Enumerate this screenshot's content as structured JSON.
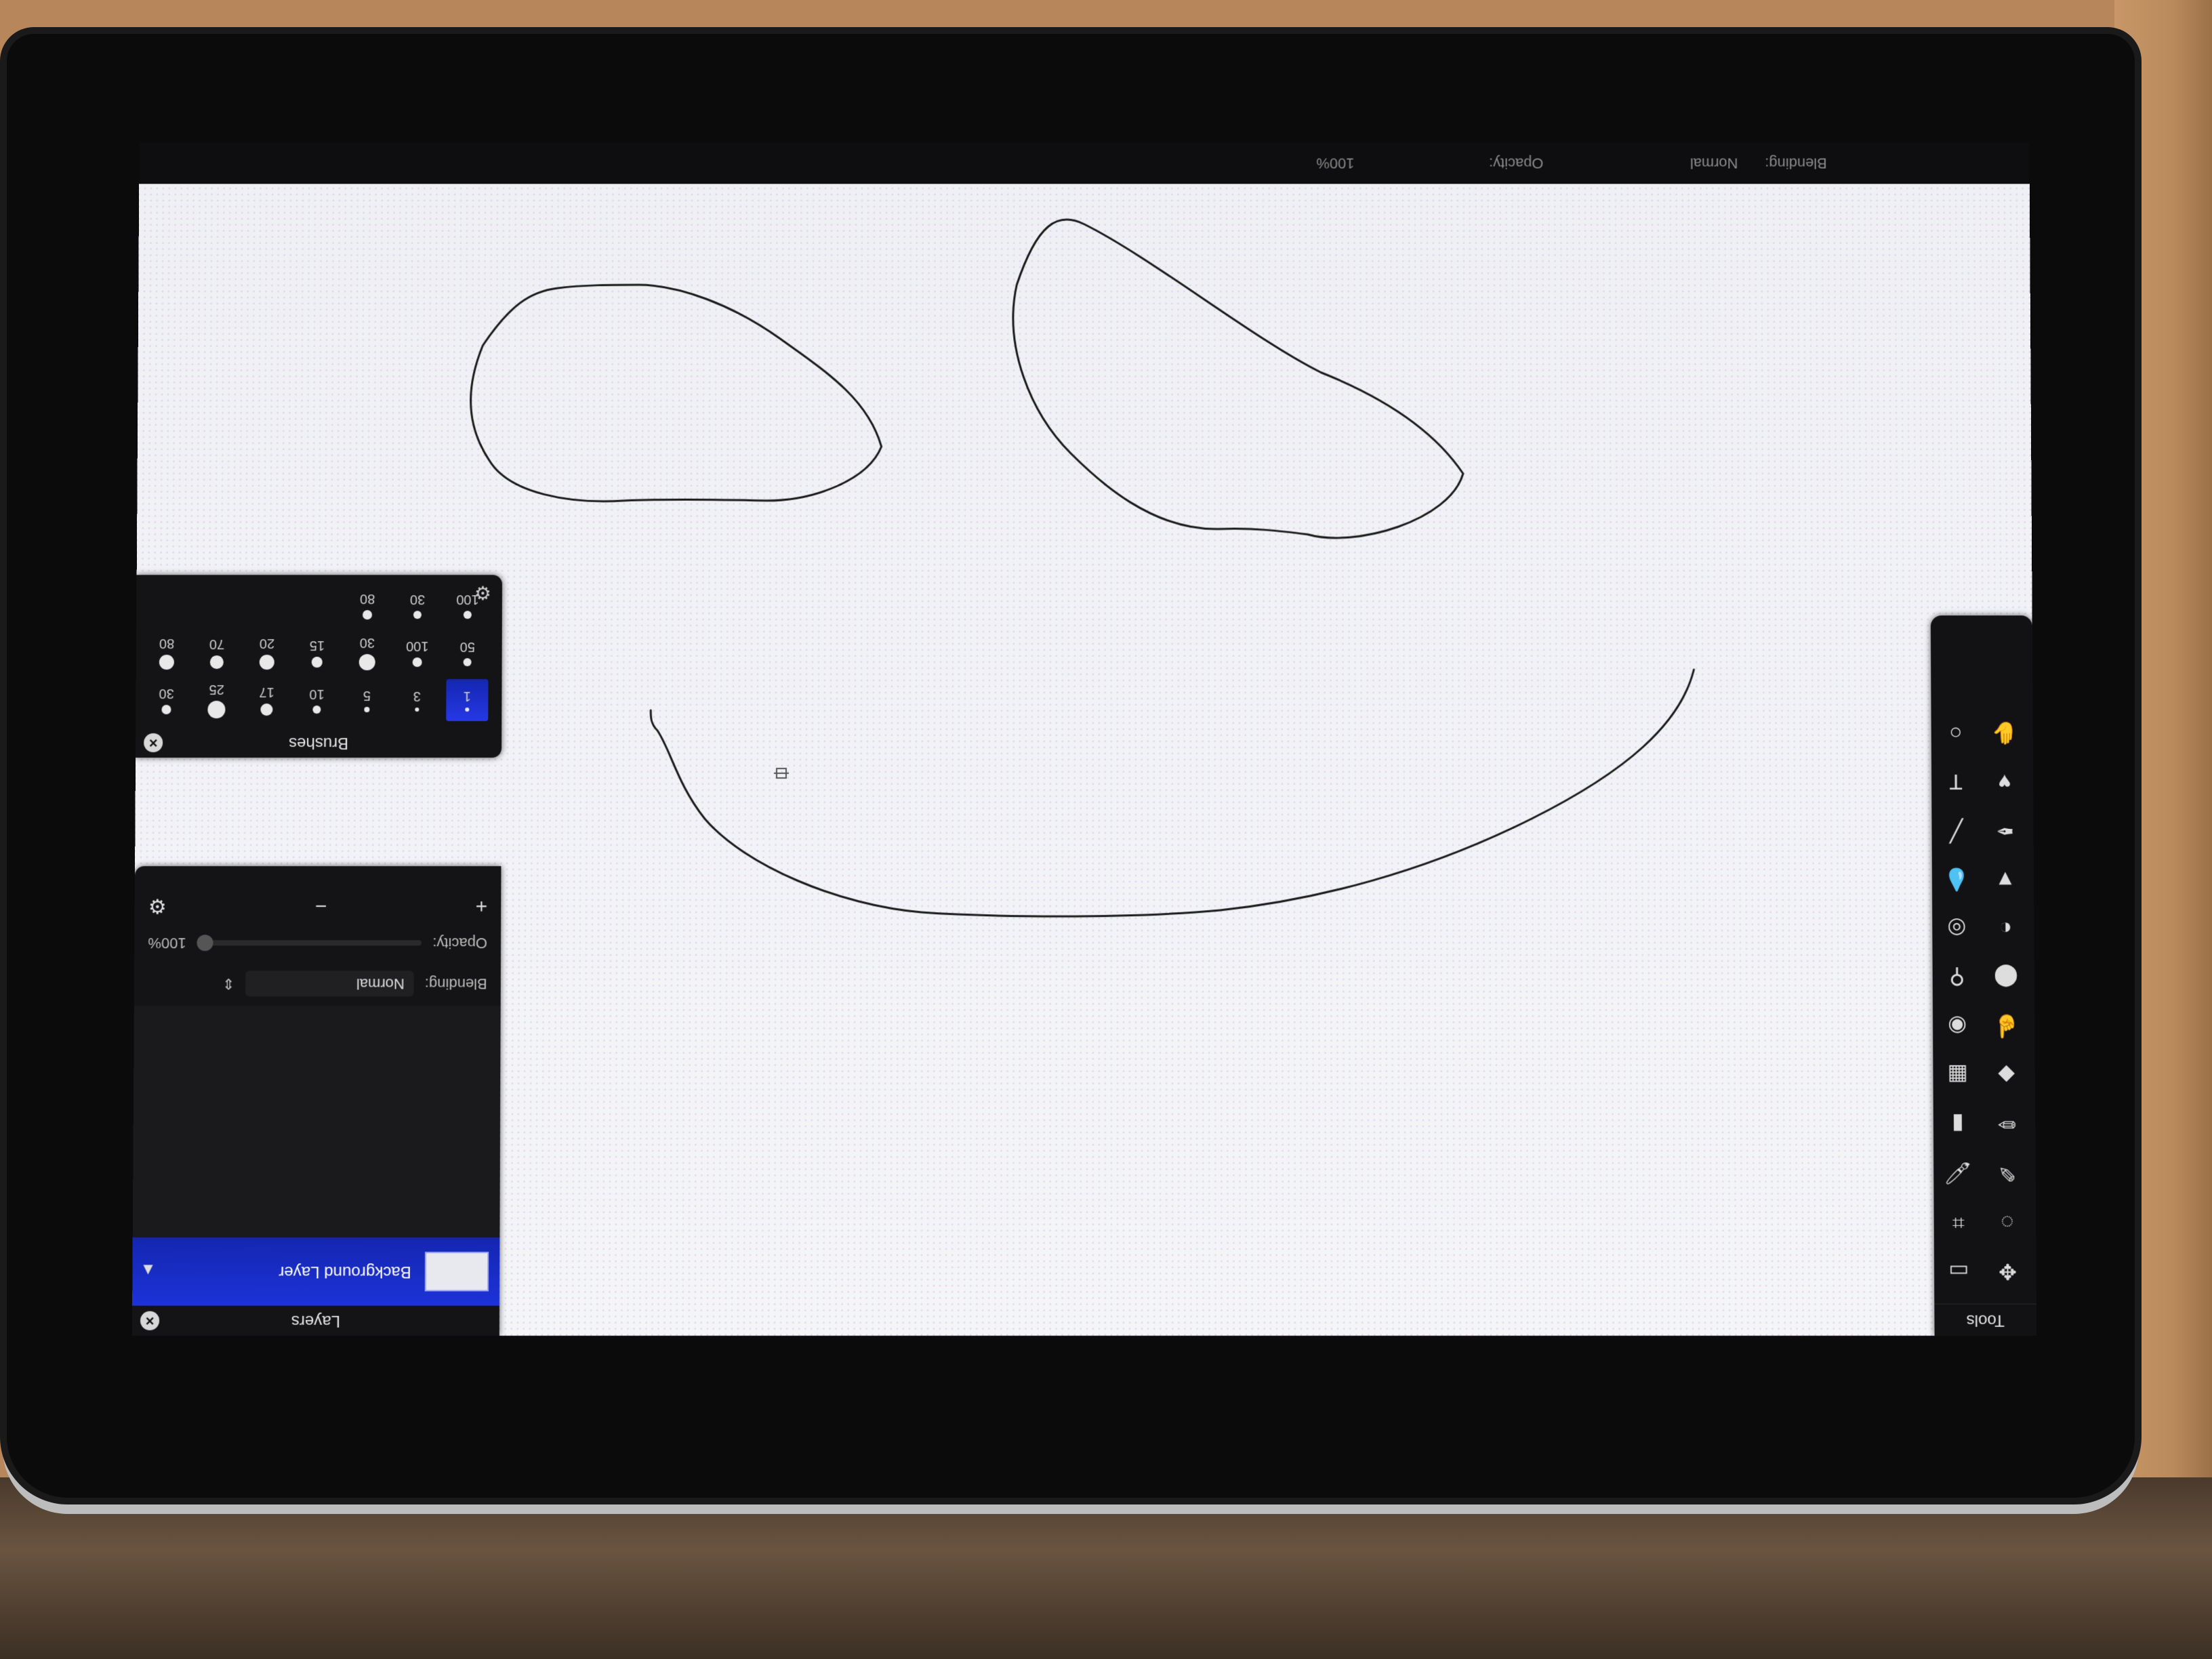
{
  "app": {
    "status_bar": {
      "blending_label": "Blending:",
      "blending_value": "Normal",
      "opacity_label": "Opacity:",
      "opacity_value": "100%"
    }
  },
  "tools_panel": {
    "title": "Tools",
    "tools": [
      {
        "icon": "move-icon",
        "glyph": "✥"
      },
      {
        "icon": "rect-select-icon",
        "glyph": "▭"
      },
      {
        "icon": "lasso-icon",
        "glyph": "◌"
      },
      {
        "icon": "crop-icon",
        "glyph": "⌗"
      },
      {
        "icon": "eyedropper-icon",
        "glyph": "✎"
      },
      {
        "icon": "brush-icon",
        "glyph": "🖌"
      },
      {
        "icon": "pencil-icon",
        "glyph": "✏"
      },
      {
        "icon": "eraser-icon",
        "glyph": "▮"
      },
      {
        "icon": "fill-icon",
        "glyph": "◆"
      },
      {
        "icon": "gradient-icon",
        "glyph": "▦"
      },
      {
        "icon": "smudge-icon",
        "glyph": "☝"
      },
      {
        "icon": "sponge-icon",
        "glyph": "◉"
      },
      {
        "icon": "burn-icon",
        "glyph": "⬤"
      },
      {
        "icon": "dodge-icon",
        "glyph": "⚲"
      },
      {
        "icon": "clone-icon",
        "glyph": "◐"
      },
      {
        "icon": "red-eye-icon",
        "glyph": "◎"
      },
      {
        "icon": "sharpen-icon",
        "glyph": "▼"
      },
      {
        "icon": "blur-icon",
        "glyph": "💧"
      },
      {
        "icon": "pen-icon",
        "glyph": "✒"
      },
      {
        "icon": "line-icon",
        "glyph": "╱"
      },
      {
        "icon": "shape-icon",
        "glyph": "♥"
      },
      {
        "icon": "text-icon",
        "glyph": "T"
      },
      {
        "icon": "hand-icon",
        "glyph": "✋"
      },
      {
        "icon": "zoom-icon",
        "glyph": "○"
      }
    ]
  },
  "layers_panel": {
    "title": "Layers",
    "layers": [
      {
        "name": "Background Layer"
      }
    ],
    "blending_label": "Blending:",
    "blending_value": "Normal",
    "opacity_label": "Opacity:",
    "opacity_value": "100%",
    "add_glyph": "+",
    "remove_glyph": "−",
    "settings_glyph": "⚙"
  },
  "brushes_panel": {
    "title": "Brushes",
    "settings_glyph": "⚙",
    "brushes": [
      {
        "size": "1",
        "selected": true,
        "dot": 6
      },
      {
        "size": "3",
        "dot": 6
      },
      {
        "size": "5",
        "dot": 8
      },
      {
        "size": "10",
        "dot": 12
      },
      {
        "size": "17",
        "dot": 18
      },
      {
        "size": "25",
        "dot": 26
      },
      {
        "size": "30",
        "dot": 14
      },
      {
        "size": "50",
        "dot": 12
      },
      {
        "size": "100",
        "dot": 14
      },
      {
        "size": "30",
        "dot": 24
      },
      {
        "size": "15",
        "dot": 16
      },
      {
        "size": "20",
        "dot": 22
      },
      {
        "size": "70",
        "dot": 20
      },
      {
        "size": "80",
        "dot": 22
      },
      {
        "size": "100",
        "dot": 12
      },
      {
        "size": "30",
        "dot": 12
      },
      {
        "size": "80",
        "dot": 14
      }
    ]
  },
  "colors": {
    "selection_blue": "#1a2fd0",
    "panel_bg": "#141416",
    "canvas_bg": "#f2f4f7",
    "stroke": "#1b1b1b"
  }
}
